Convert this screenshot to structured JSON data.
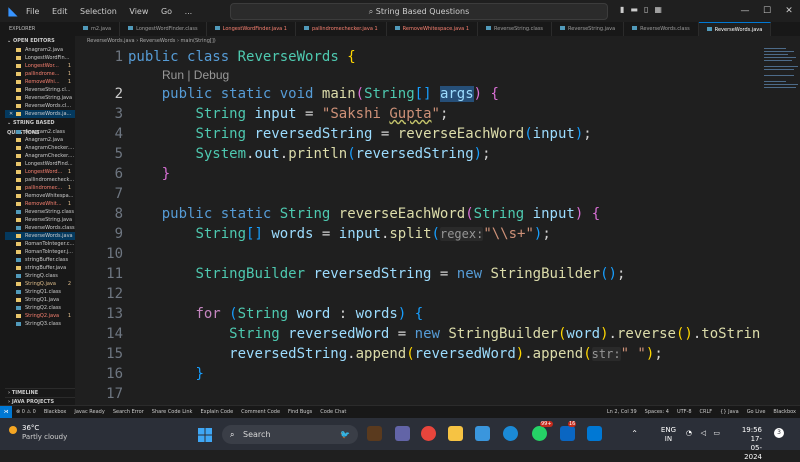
{
  "window": {
    "menu": [
      "File",
      "Edit",
      "Selection",
      "View",
      "Go",
      "..."
    ],
    "search_text": "String Based Questions"
  },
  "sidebar": {
    "title": "EXPLORER",
    "open_editors_label": "OPEN EDITORS",
    "open_editors": [
      {
        "name": "Anagram2.java",
        "state": "normal"
      },
      {
        "name": "LongestWordFin...",
        "state": "normal"
      },
      {
        "name": "LongestWor...",
        "state": "err",
        "badge": "1"
      },
      {
        "name": "pallindrome...",
        "state": "err",
        "badge": "1"
      },
      {
        "name": "RemoveWhi...",
        "state": "err",
        "badge": "1"
      },
      {
        "name": "ReverseString.cl...",
        "state": "normal"
      },
      {
        "name": "ReverseString.java",
        "state": "normal"
      },
      {
        "name": "ReverseWords.cl...",
        "state": "normal"
      },
      {
        "name": "ReverseWords.ja...",
        "state": "sel",
        "closable": true
      }
    ],
    "folder_label": "STRING BASED QUESTIONS",
    "files": [
      {
        "name": "Anagram2.class",
        "state": "normal"
      },
      {
        "name": "Anagram2.java",
        "state": "normal"
      },
      {
        "name": "AnagramChecker....",
        "state": "normal"
      },
      {
        "name": "AnagramChecker....",
        "state": "normal"
      },
      {
        "name": "LongestWordFind...",
        "state": "normal"
      },
      {
        "name": "LongestWord...",
        "state": "err",
        "badge": "1"
      },
      {
        "name": "pallindromecheck...",
        "state": "normal"
      },
      {
        "name": "pallindromec...",
        "state": "err",
        "badge": "1"
      },
      {
        "name": "RemoveWhitespa...",
        "state": "normal"
      },
      {
        "name": "RemoveWhit...",
        "state": "err",
        "badge": "1"
      },
      {
        "name": "ReverseString.class",
        "state": "normal"
      },
      {
        "name": "ReverseString.java",
        "state": "normal"
      },
      {
        "name": "ReverseWords.class",
        "state": "normal"
      },
      {
        "name": "ReverseWords.java",
        "state": "sel"
      },
      {
        "name": "RomanToInteger.c...",
        "state": "normal"
      },
      {
        "name": "RomanToInteger.j...",
        "state": "normal"
      },
      {
        "name": "stringBuffer.class",
        "state": "normal"
      },
      {
        "name": "stringBuffer.java",
        "state": "normal"
      },
      {
        "name": "StringQ.class",
        "state": "normal"
      },
      {
        "name": "StringQ.java",
        "state": "warn",
        "badge": "2"
      },
      {
        "name": "StringQ1.class",
        "state": "normal"
      },
      {
        "name": "StringQ1.java",
        "state": "normal"
      },
      {
        "name": "StringQ2.class",
        "state": "normal"
      },
      {
        "name": "StringQ2.java",
        "state": "err",
        "badge": "1"
      },
      {
        "name": "StringQ3.class",
        "state": "normal"
      }
    ],
    "timeline_label": "TIMELINE",
    "java_projects_label": "JAVA PROJECTS"
  },
  "tabs": [
    {
      "label": "m2.java",
      "state": "normal"
    },
    {
      "label": "LongestWordFinder.class",
      "state": "normal"
    },
    {
      "label": "LongestWordFinder.java 1",
      "state": "err"
    },
    {
      "label": "pallindromechecker.java 1",
      "state": "err"
    },
    {
      "label": "RemoveWhitespace.java 1",
      "state": "err"
    },
    {
      "label": "ReverseString.class",
      "state": "normal"
    },
    {
      "label": "ReverseString.java",
      "state": "normal"
    },
    {
      "label": "ReverseWords.class",
      "state": "normal"
    },
    {
      "label": "ReverseWords.java",
      "state": "active"
    }
  ],
  "breadcrumb": "ReverseWords.java › ReverseWords › main(String[])",
  "editor": {
    "codelens": "Run | Debug",
    "line_numbers": [
      "1",
      "2",
      "3",
      "4",
      "5",
      "6",
      "7",
      "8",
      "9",
      "10",
      "11",
      "12",
      "13",
      "14",
      "15",
      "16",
      "17"
    ],
    "current_line": "2",
    "hints": {
      "regex": "regex:",
      "str": "str:"
    }
  },
  "statusbar": {
    "left": [
      "⊗ 0 ⚠ 0",
      "Blackbox",
      "Javac Ready",
      "Search Error",
      "Share Code Link",
      "Explain Code",
      "Comment Code",
      "Find Bugs",
      "Code Chat"
    ],
    "right": [
      "Ln 2, Col 39",
      "Spaces: 4",
      "UTF-8",
      "CRLF",
      "{} Java",
      "Go Live",
      "Blackbox"
    ]
  },
  "taskbar": {
    "temperature": "36°C",
    "weather": "Partly cloudy",
    "search_label": "Search",
    "lang_top": "ENG",
    "lang_bottom": "IN",
    "time": "19:56",
    "date": "17-05-2024",
    "notify_count": "3",
    "ms_badge": "99+",
    "teams_badge": "16"
  },
  "colors": {
    "accent": "#0078d4",
    "error_text": "#f88070",
    "keyword": "#569cd6",
    "type": "#4ec9b0",
    "function": "#dcdcaa",
    "variable": "#9cdcfe",
    "string": "#ce9178"
  }
}
